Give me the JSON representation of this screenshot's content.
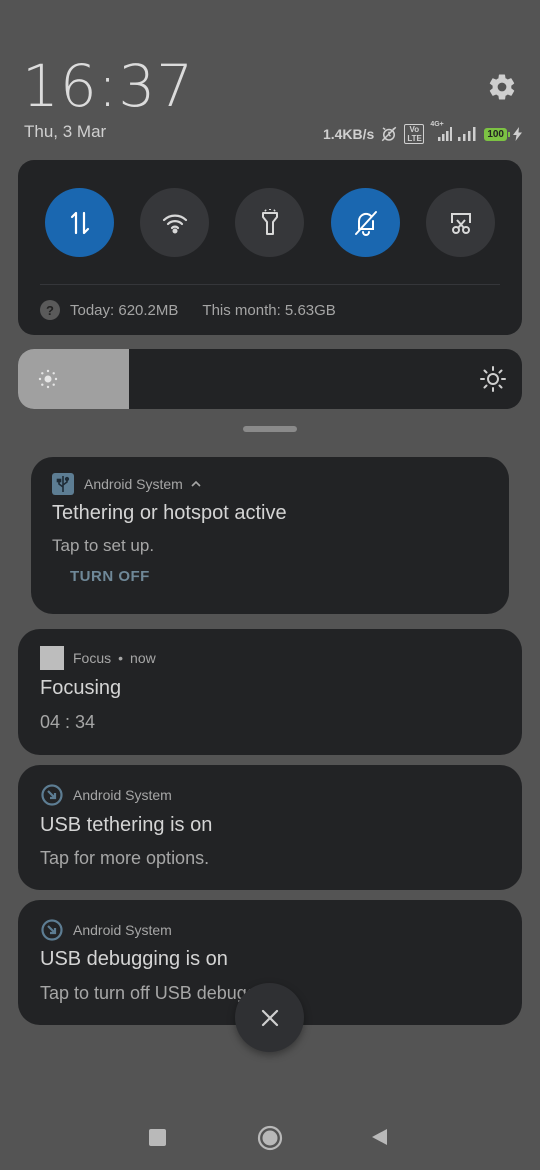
{
  "header": {
    "time": "16:37",
    "date": "Thu, 3 Mar",
    "net_speed": "1.4KB/s",
    "network_type": "4G+",
    "volte": "Vo LTE",
    "battery": "100"
  },
  "quick_settings": {
    "tiles": [
      {
        "name": "mobile-data",
        "icon": "data-arrows-icon",
        "active": true
      },
      {
        "name": "wifi",
        "icon": "wifi-icon",
        "active": false
      },
      {
        "name": "flashlight",
        "icon": "flashlight-icon",
        "active": false
      },
      {
        "name": "silent",
        "icon": "bell-off-icon",
        "active": true
      },
      {
        "name": "screenshot",
        "icon": "scissors-icon",
        "active": false
      }
    ],
    "usage_today": "Today: 620.2MB",
    "usage_month": "This month: 5.63GB",
    "help_glyph": "?"
  },
  "brightness": {
    "level_percent": 22
  },
  "notifications": [
    {
      "app": "Android System",
      "title": "Tethering or hotspot active",
      "body": "Tap to set up.",
      "action": "TURN OFF"
    },
    {
      "app": "Focus",
      "time": "now",
      "separator": "•",
      "title": "Focusing",
      "body": "04 : 34"
    },
    {
      "app": "Android System",
      "title": "USB tethering is on",
      "body": "Tap for more options."
    },
    {
      "app": "Android System",
      "title": "USB debugging is on",
      "body": "Tap to turn off USB debugging"
    }
  ],
  "colors": {
    "accent": "#1a67b0",
    "panel": "#222325",
    "backdrop": "#545454",
    "battery": "#7cc243"
  }
}
